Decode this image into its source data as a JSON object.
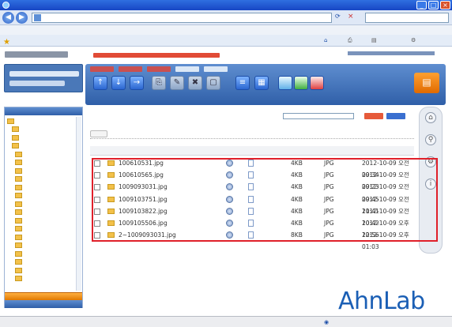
{
  "window": {
    "title": ""
  },
  "address": {
    "url": "",
    "search_placeholder": ""
  },
  "menu": [
    "",
    "",
    "",
    "",
    "",
    ""
  ],
  "favorites": {
    "tab": ""
  },
  "toolbar": {
    "buttons": [
      "",
      "",
      "",
      "",
      "",
      "",
      "",
      "",
      "",
      "",
      "",
      "",
      ""
    ]
  },
  "main": {
    "breadcrumb": "",
    "quota_label": "",
    "subbar_text": "",
    "columns": {
      "name": "",
      "ext": "",
      "tag": "",
      "size": "",
      "type": "",
      "date": ""
    },
    "files": [
      {
        "name": "100610531.jpg",
        "size": "4KB",
        "type": "JPG",
        "date": "2012-10-09 오전 09:34"
      },
      {
        "name": "100610565.jpg",
        "size": "4KB",
        "type": "JPG",
        "date": "2012-10-09 오전 09:23"
      },
      {
        "name": "1009093031.jpg",
        "size": "4KB",
        "type": "JPG",
        "date": "2012-10-09 오전 09:45"
      },
      {
        "name": "1009103751.jpg",
        "size": "4KB",
        "type": "JPG",
        "date": "2012-10-09 오전 11:41"
      },
      {
        "name": "1009103822.jpg",
        "size": "4KB",
        "type": "JPG",
        "date": "2012-10-09 오전 10:42"
      },
      {
        "name": "1009105506.jpg",
        "size": "4KB",
        "type": "JPG",
        "date": "2012-10-09 오후 12:56"
      },
      {
        "name": "2~1009093031.jpg",
        "size": "8KB",
        "type": "JPG",
        "date": "2012-10-09 오후 01:03"
      }
    ]
  },
  "sidebar": {
    "folders": [
      "",
      "",
      "",
      "",
      "",
      "",
      "",
      "",
      "",
      "",
      "",
      "",
      "",
      "",
      "",
      "",
      "",
      "",
      "",
      ""
    ],
    "bottom_btn": "",
    "bottom_btn2": ""
  },
  "brand": "AhnLab",
  "status": {
    "left": "",
    "zone": "",
    "zoom": ""
  },
  "colors": {
    "accent": "#2f5fa8",
    "highlight": "#e0202a",
    "brand": "#1b5fb5"
  }
}
